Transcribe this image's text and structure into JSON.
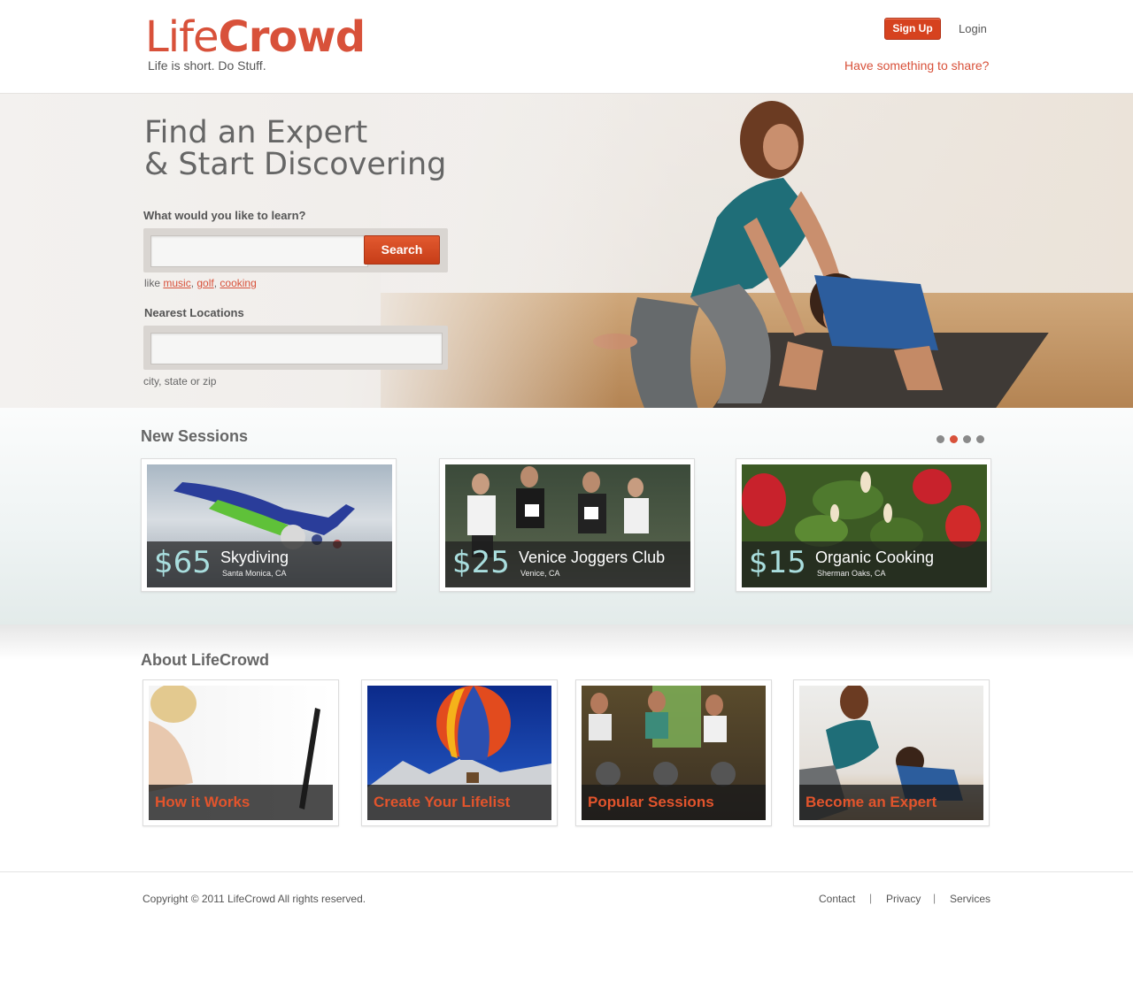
{
  "header": {
    "logo_light": "Life",
    "logo_bold": "Crowd",
    "tagline": "Life is short. Do Stuff.",
    "signup_label": "Sign Up",
    "login_label": "Login",
    "share_link": "Have something to share?"
  },
  "hero": {
    "title_line1": "Find an Expert",
    "title_line2": "& Start Discovering",
    "learn_label": "What would you like to learn?",
    "search_label": "Search",
    "hint_prefix": "like",
    "hint_links": [
      "music",
      "golf",
      "cooking"
    ],
    "location_label": "Nearest Locations",
    "location_hint": "city, state or zip"
  },
  "sessions": {
    "title": "New Sessions",
    "cards": [
      {
        "price": "$65",
        "name": "Skydiving",
        "location": "Santa Monica, CA"
      },
      {
        "price": "$25",
        "name": "Venice Joggers Club",
        "location": "Venice, CA"
      },
      {
        "price": "$15",
        "name": "Organic Cooking",
        "location": "Sherman Oaks, CA"
      }
    ]
  },
  "about": {
    "title": "About LifeCrowd",
    "cards": [
      {
        "label": "How it Works"
      },
      {
        "label": "Create Your Lifelist"
      },
      {
        "label": "Popular Sessions"
      },
      {
        "label": "Become an Expert"
      }
    ]
  },
  "footer": {
    "copyright": "Copyright © 2011 LifeCrowd All rights reserved.",
    "links": [
      "Contact",
      "Privacy",
      "Services"
    ],
    "separator": "|"
  },
  "colors": {
    "brand": "#d8513a",
    "button": "#d6421f",
    "price": "#a9dede"
  }
}
